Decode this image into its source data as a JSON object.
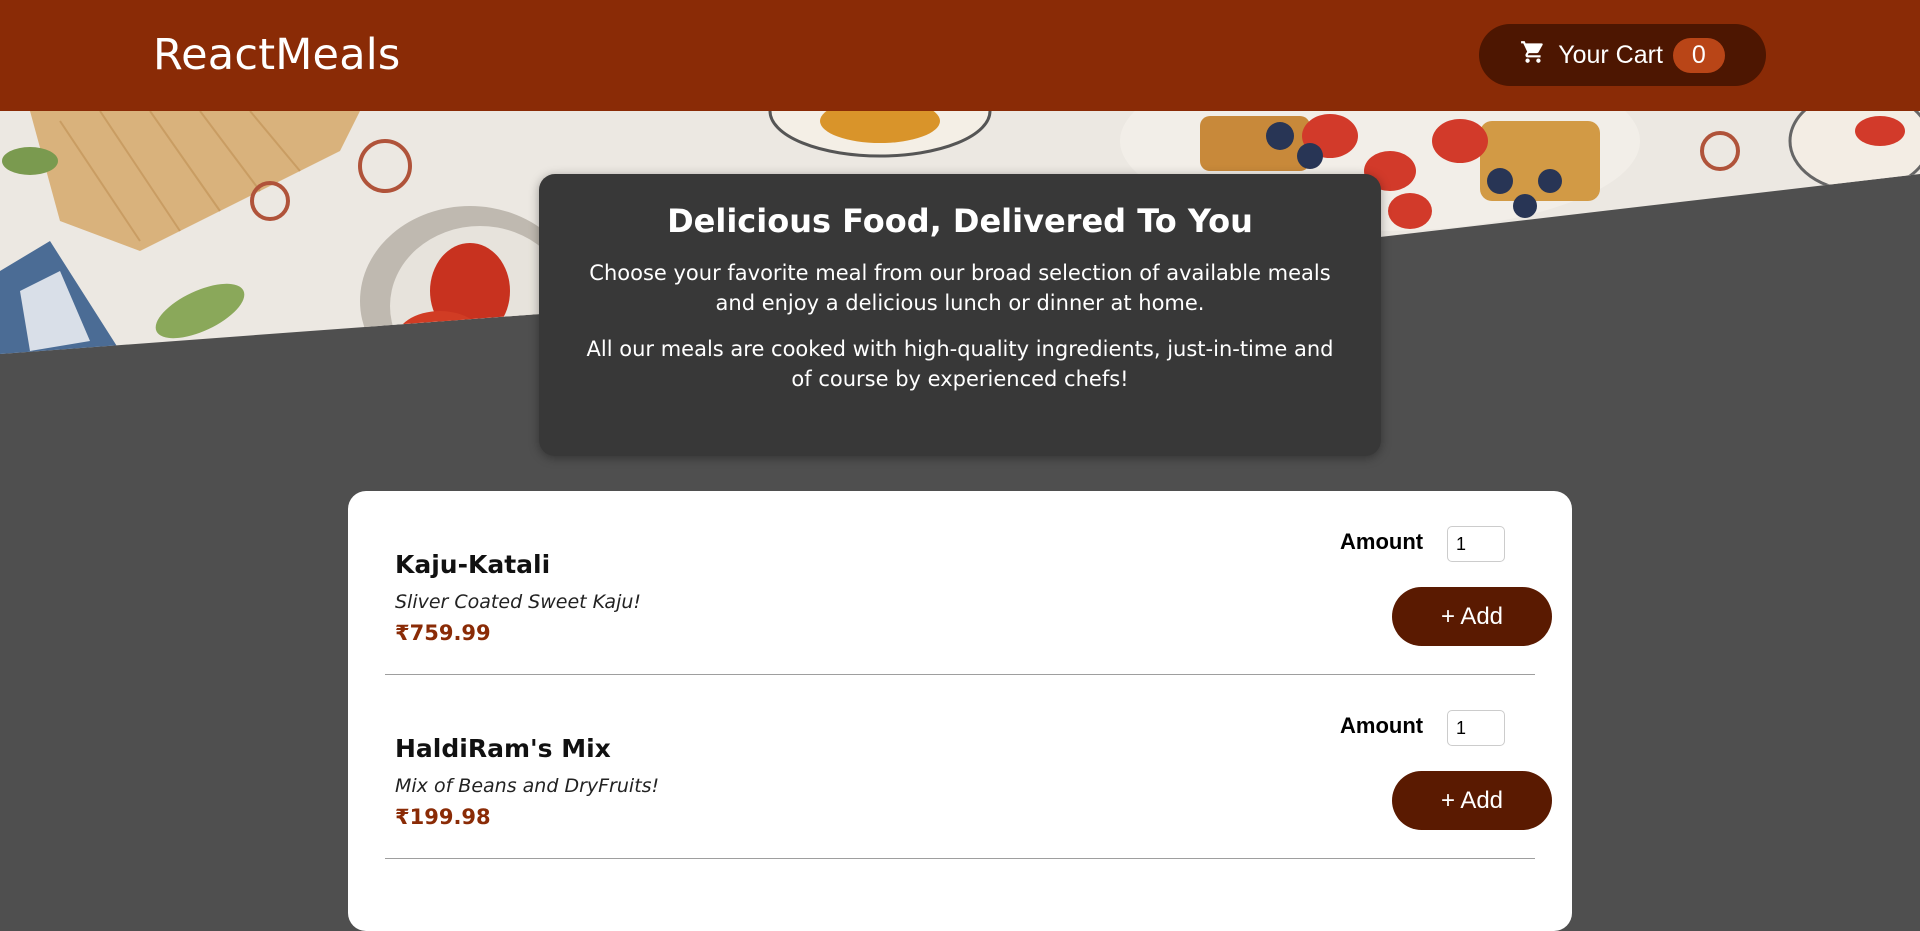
{
  "header": {
    "logo": "ReactMeals",
    "cart_label": "Your Cart",
    "cart_count": "0",
    "cart_icon": "shopping-cart-icon"
  },
  "colors": {
    "header_bg": "#8a2b06",
    "cart_button_bg": "#4d1601",
    "badge_bg": "#b94517",
    "page_bg": "#4f4f4f",
    "summary_bg": "#383838",
    "add_button_bg": "#5a1a01",
    "price": "#8a2b06"
  },
  "summary": {
    "title": "Delicious Food, Delivered To You",
    "paragraph1": "Choose your favorite meal from our broad selection of available meals and enjoy a delicious lunch or dinner at home.",
    "paragraph2": "All our meals are cooked with high-quality ingredients, just-in-time and of course by experienced chefs!"
  },
  "meals": [
    {
      "name": "Kaju-Katali",
      "description": "Sliver Coated Sweet Kaju!",
      "price": "₹759.99",
      "amount_label": "Amount",
      "amount_value": "1",
      "add_label": "+ Add"
    },
    {
      "name": "HaldiRam's Mix",
      "description": "Mix of Beans and DryFruits!",
      "price": "₹199.98",
      "amount_label": "Amount",
      "amount_value": "1",
      "add_label": "+ Add"
    }
  ]
}
